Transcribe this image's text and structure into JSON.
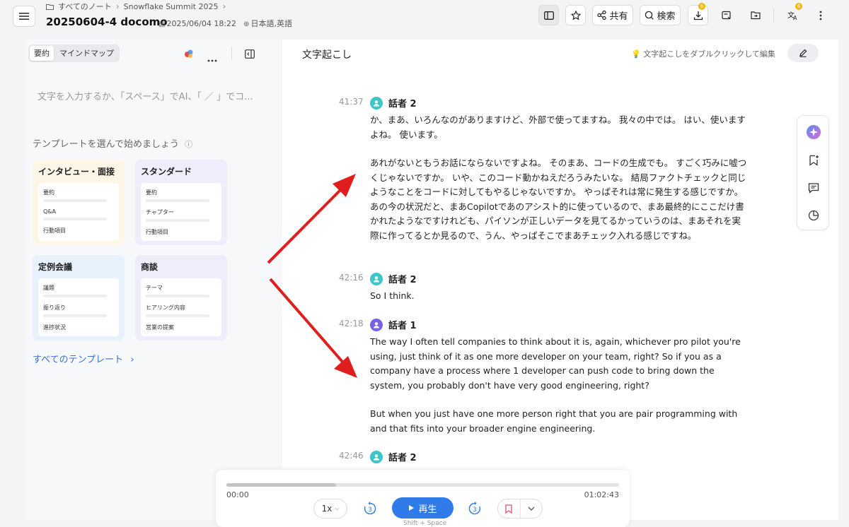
{
  "header": {
    "breadcrumb": [
      "すべてのノート",
      "Snowflake Summit 2025"
    ],
    "title": "20250604-4 docomo",
    "date": "2025/06/04 18:22",
    "language": "日本語,英語",
    "share_label": "共有",
    "search_label": "検索",
    "download_badge": "6",
    "translate_badge": "6"
  },
  "left": {
    "tabs": [
      "要約",
      "マインドマップ"
    ],
    "editor_placeholder": "文字を入力するか、「スペース」でAI、「 ／ 」でコ...",
    "template_heading": "テンプレートを選んで始めましょう",
    "templates": [
      {
        "title": "インタビュー・面接",
        "rows": [
          "要約",
          "Q&A",
          "行動項目"
        ],
        "color": "#fdf6e7"
      },
      {
        "title": "スタンダード",
        "rows": [
          "要約",
          "チャプター",
          "行動項目"
        ],
        "color": "#efedfb"
      },
      {
        "title": "定例会議",
        "rows": [
          "議題",
          "振り返り",
          "進捗状況"
        ],
        "color": "#e7f2fc"
      },
      {
        "title": "商談",
        "rows": [
          "テーマ",
          "ヒアリング内容",
          "営業の提案"
        ],
        "color": "#efedfb"
      }
    ],
    "all_templates": "すべてのテンプレート"
  },
  "main": {
    "title": "文字起こし",
    "hint": "文字起こしをダブルクリックして編集",
    "segments": [
      {
        "time": "41:37",
        "speaker": "話者 2",
        "avatar_color": "#3cc6c9",
        "paragraphs": [
          "か、まあ、いろんなのがありますけど、外部で使ってますね。 我々の中では。 はい、使いますよね。 使います。",
          "あれがないともうお話にならないですよね。 そのまあ、コードの生成でも。 すごく巧みに嘘つくじゃないですか。 いや、このコード動かねえだろうみたいな。 結局ファクトチェックと同じようなことをコードに対してもやるじゃないですか。 やっぱそれは常に発生する感じですか。 あの今の状況だと、まあCopilotであのアシスト的に使っているので、まあ最終的にここだけ書かれたようなですけれども、パイソンが正しいデータを見てるかっていうのは、まあそれを実際に作ってるとか見るので、うん、やっぱそこでまあチェック入れる感じですね。"
        ]
      },
      {
        "time": "42:16",
        "speaker": "話者 2",
        "avatar_color": "#3cc6c9",
        "paragraphs": [
          "So I think."
        ]
      },
      {
        "time": "42:18",
        "speaker": "話者 1",
        "avatar_color": "#7b61e4",
        "paragraphs": [
          "The way I often tell companies to think about it is, again, whichever pro pilot you're using, just think of it as one more developer on your team, right? So if you as a company have a process where 1 developer can push code to bring down the system, you probably don't have very good engineering, right?",
          "But when you just have one more person right that you are pair programming with and that fits into your broader engine engineering."
        ]
      },
      {
        "time": "42:46",
        "speaker": "話者 2",
        "avatar_color": "#3cc6c9",
        "paragraphs": []
      }
    ]
  },
  "player": {
    "current": "00:00",
    "total": "01:02:43",
    "progress": 0.28,
    "speed": "1x",
    "skip_back": "3",
    "skip_forward": "3",
    "play_label": "再生",
    "shortcut": "Shift + Space"
  }
}
